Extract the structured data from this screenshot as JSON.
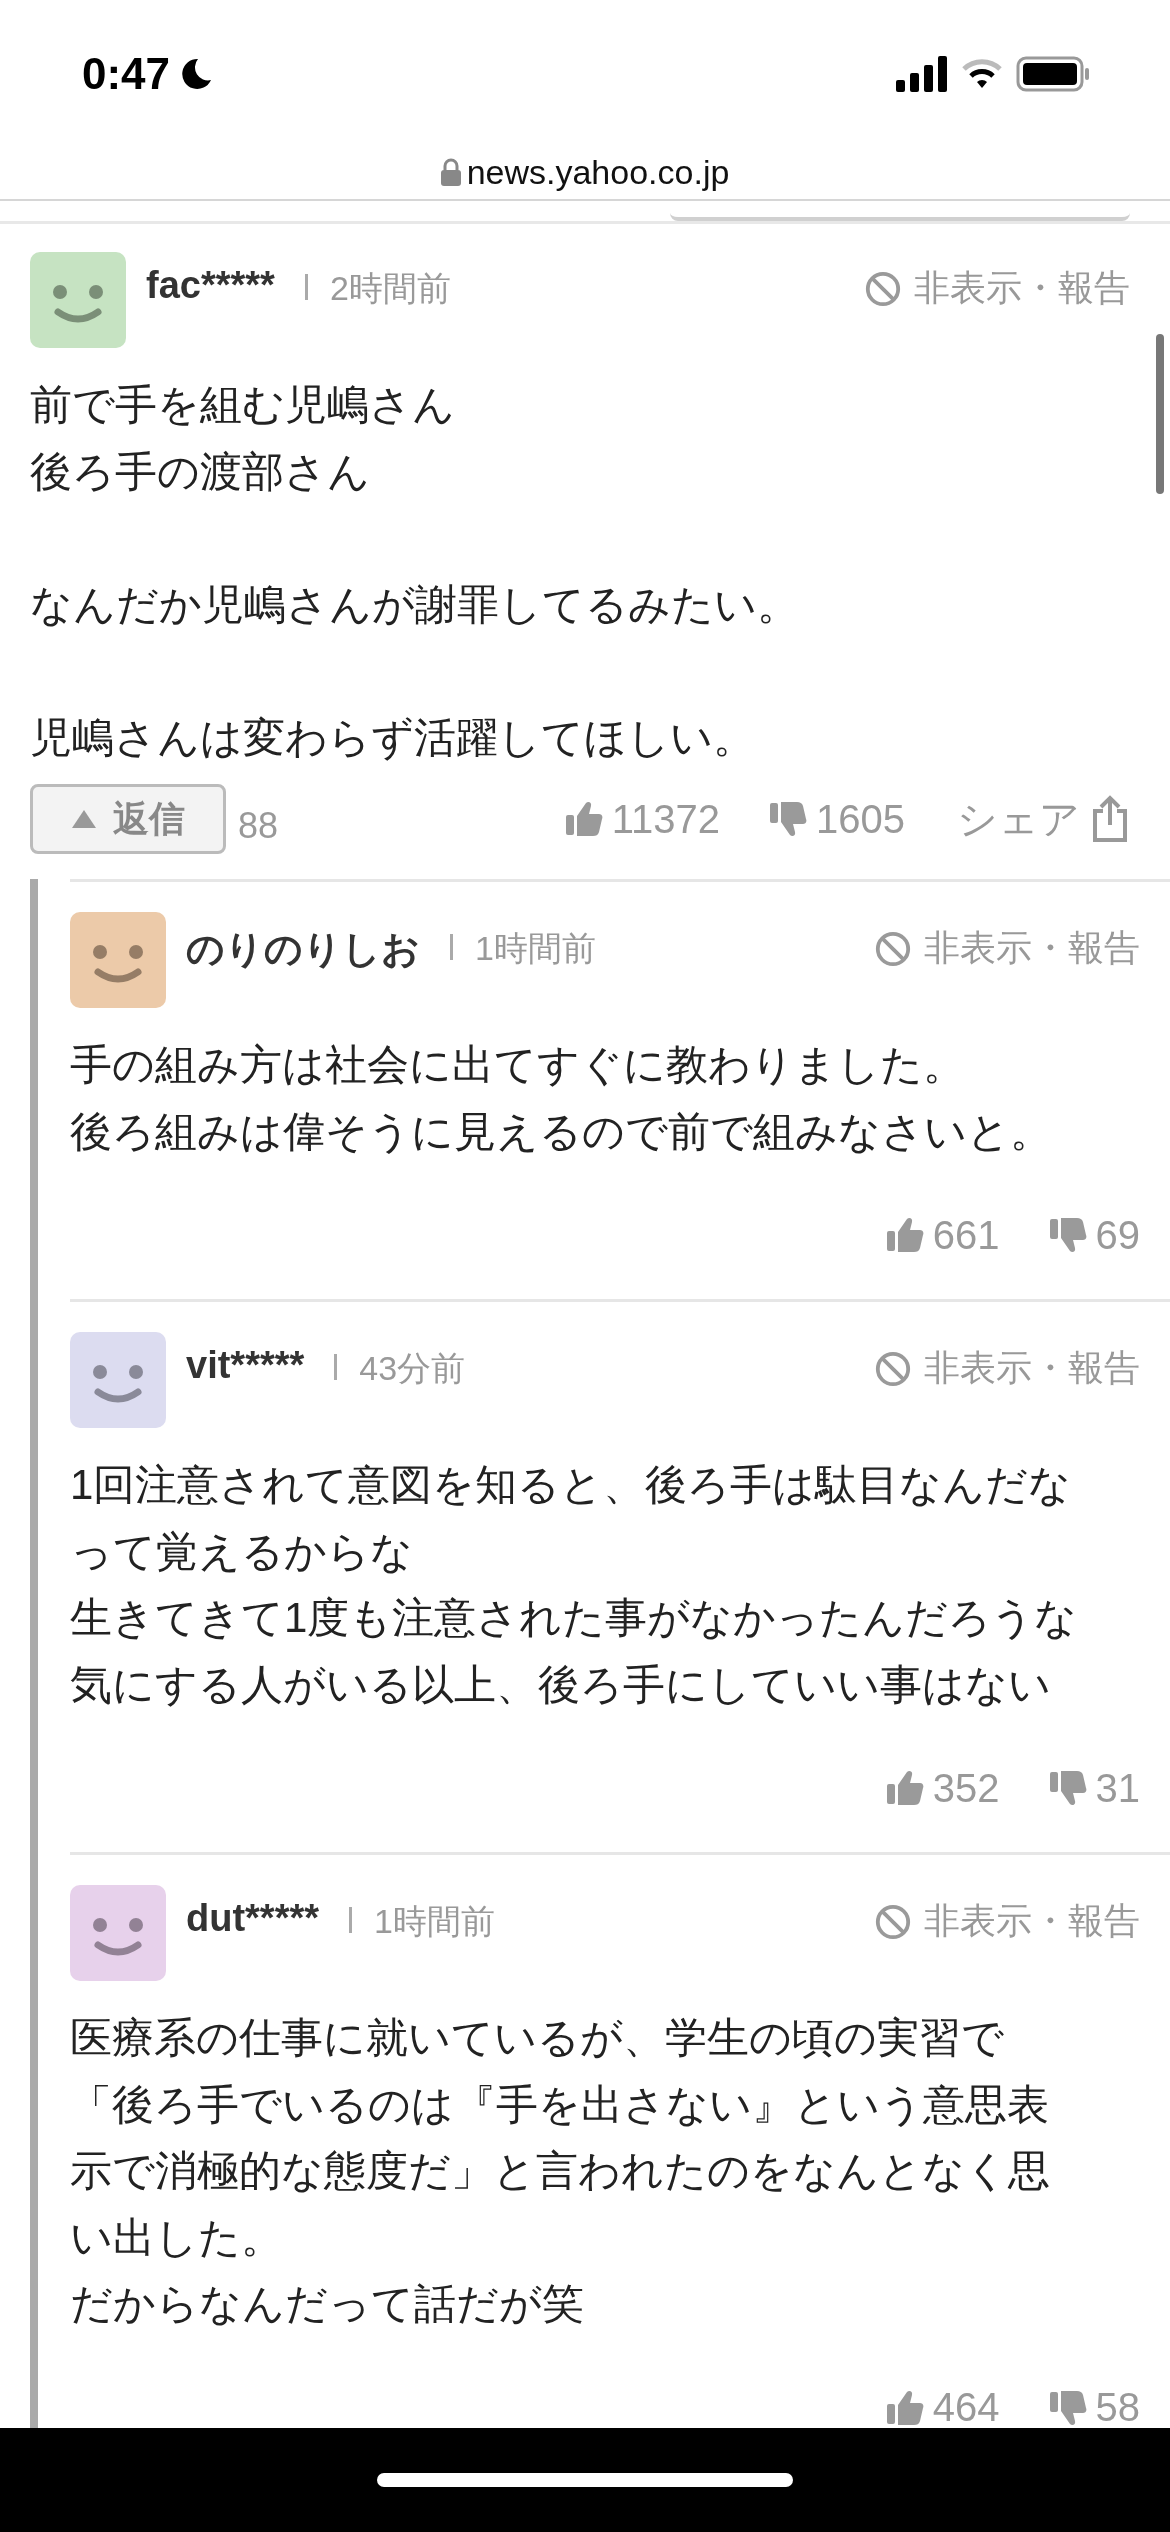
{
  "status_bar": {
    "time": "0:47"
  },
  "address_bar": {
    "url": "news.yahoo.co.jp"
  },
  "comment": {
    "user": "fac*****",
    "time": "2時間前",
    "hide_report": "非表示・報告",
    "color": "#c6e3c2",
    "paragraphs": [
      {
        "lines": [
          "前で手を組む児嶋さん",
          "後ろ手の渡部さん"
        ]
      },
      {
        "lines": [
          "なんだか児嶋さんが謝罪してるみたい。"
        ]
      },
      {
        "lines": [
          "児嶋さんは変わらず活躍してほしい。"
        ]
      }
    ],
    "reply_button": "返信",
    "reply_count": "88",
    "likes": "11372",
    "dislikes": "1605",
    "share": "シェア"
  },
  "replies": [
    {
      "user": "のりのりしお",
      "time": "1時間前",
      "hide_report": "非表示・報告",
      "color": "#eccaa9",
      "lines": [
        "手の組み方は社会に出てすぐに教わりました。",
        "後ろ組みは偉そうに見えるので前で組みなさいと。"
      ],
      "likes": "661",
      "dislikes": "69"
    },
    {
      "user": "vit*****",
      "time": "43分前",
      "hide_report": "非表示・報告",
      "color": "#dcdcf0",
      "lines": [
        "1回注意されて意図を知ると、後ろ手は駄目なんだな",
        "って覚えるからな",
        "生きてきて1度も注意された事がなかったんだろうな",
        "気にする人がいる以上、後ろ手にしていい事はない"
      ],
      "likes": "352",
      "dislikes": "31"
    },
    {
      "user": "dut*****",
      "time": "1時間前",
      "hide_report": "非表示・報告",
      "color": "#e7d1eb",
      "lines": [
        "医療系の仕事に就いているが、学生の頃の実習で",
        "「後ろ手でいるのは『手を出さない』という意思表",
        "示で消極的な態度だ」と言われたのをなんとなく思",
        "い出した。",
        "だからなんだって話だが笑"
      ],
      "likes": "464",
      "dislikes": "58"
    }
  ]
}
